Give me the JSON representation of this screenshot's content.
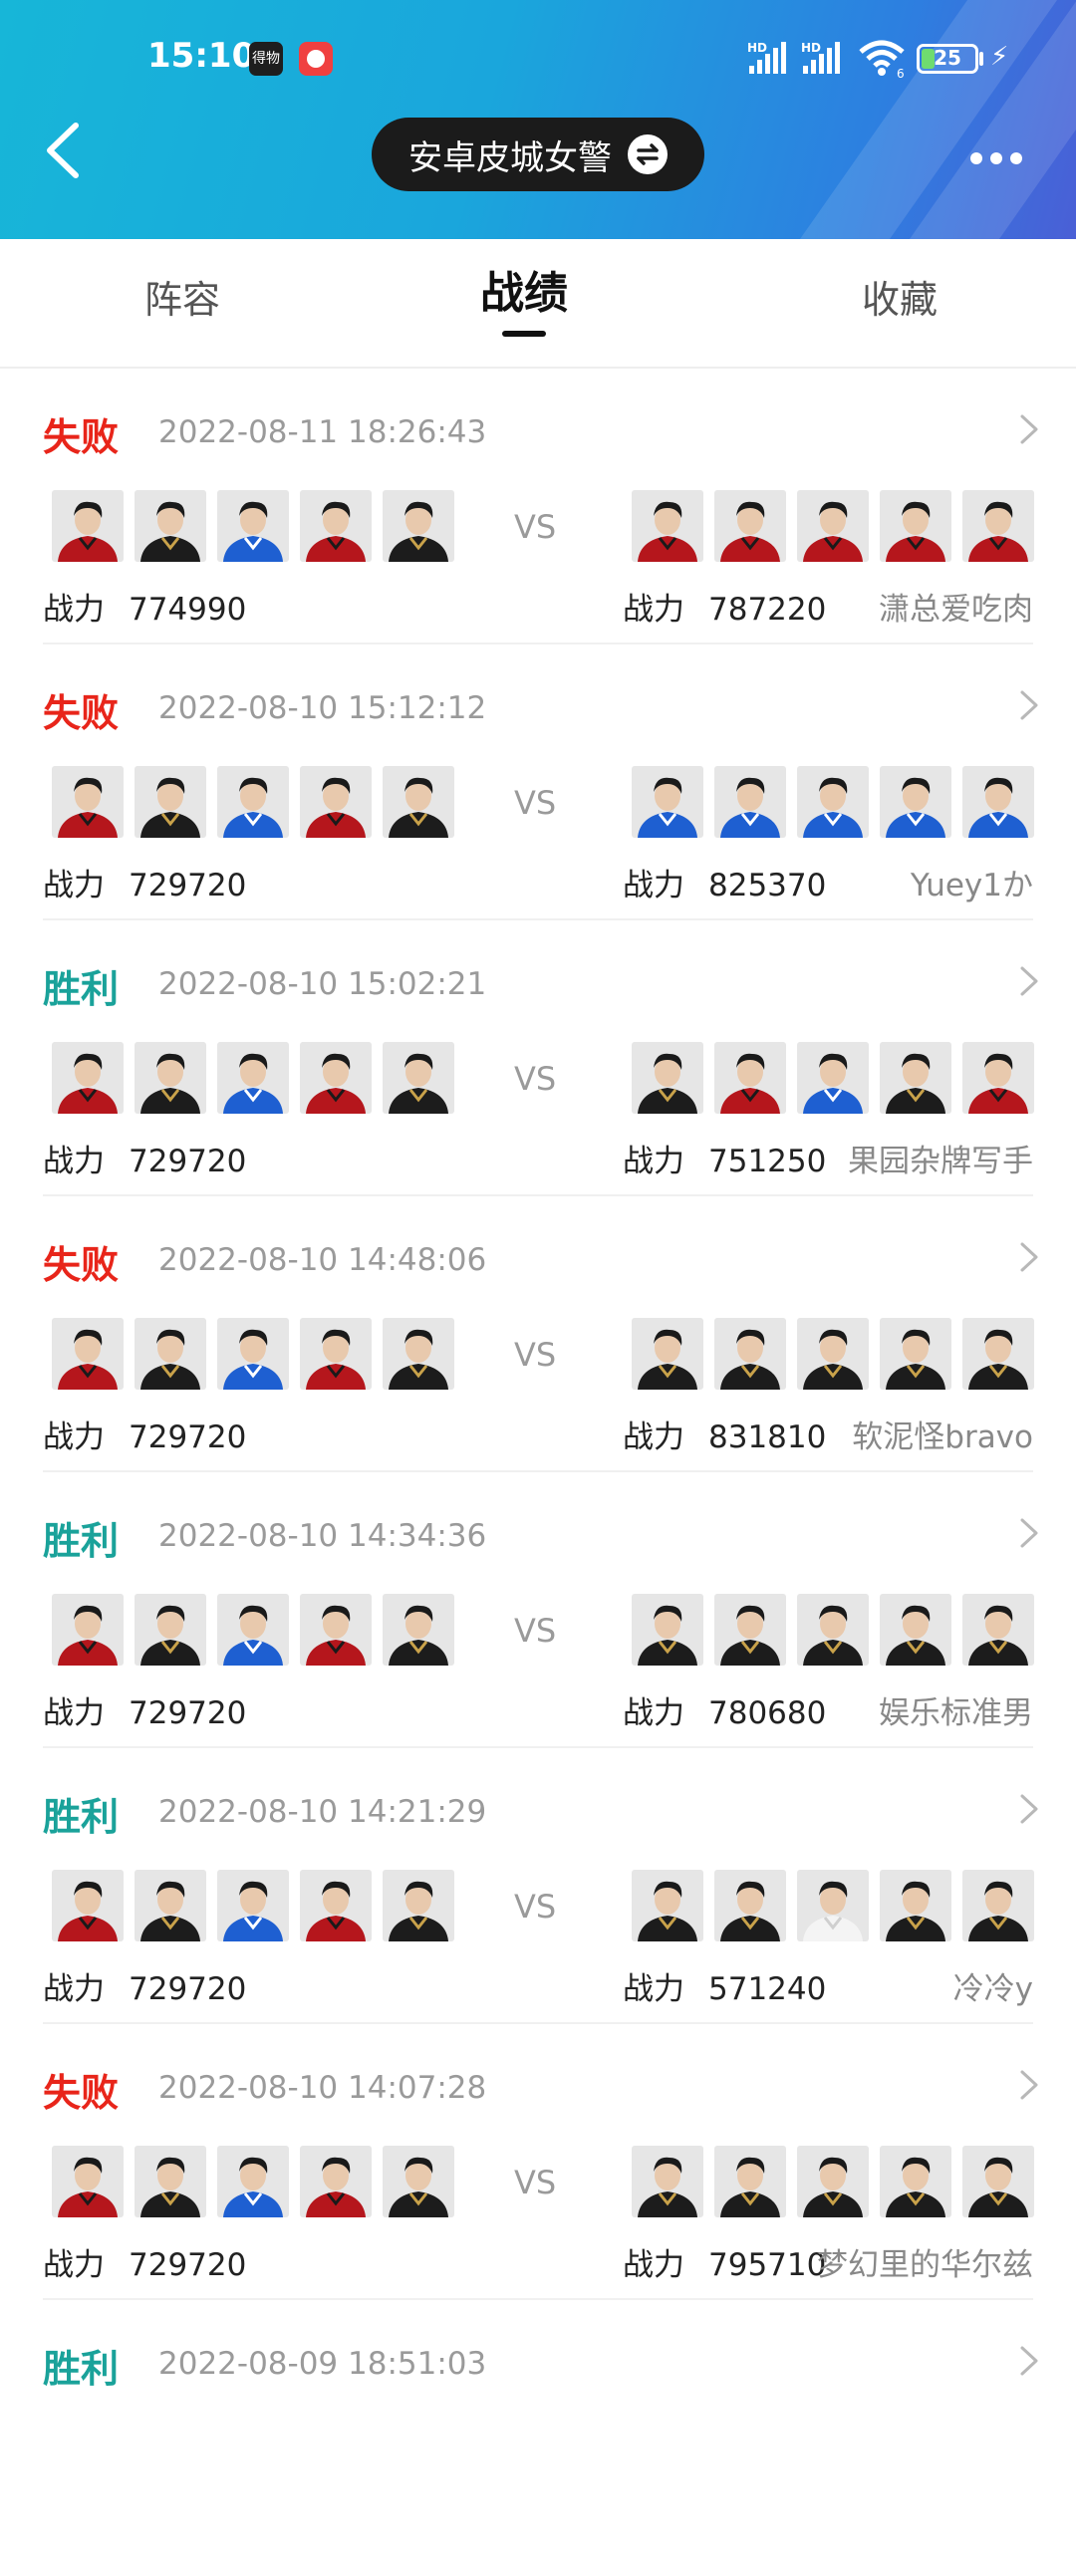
{
  "status_bar": {
    "time": "15:10",
    "app1_label": "得物",
    "battery": "25",
    "battery_level": 0.25,
    "network_1": "HD",
    "network_2": "HD",
    "wifi_label": "6"
  },
  "header": {
    "account_name": "安卓皮城女警"
  },
  "tabs": [
    {
      "label": "阵容",
      "active": false
    },
    {
      "label": "战绩",
      "active": true
    },
    {
      "label": "收藏",
      "active": false
    }
  ],
  "labels": {
    "vs": "VS",
    "power": "战力"
  },
  "colors": {
    "loss": "#e8251a",
    "win": "#1aa29a",
    "header_start": "#17b6d8",
    "header_end": "#4a5fd6"
  },
  "matches": [
    {
      "result": "失败",
      "outcome": "loss",
      "datetime": "2022-08-11 18:26:43",
      "my_power": "774990",
      "opp_power": "787220",
      "opponent": "潇总爱吃肉",
      "my_team": [
        "red",
        "black",
        "blue",
        "red",
        "black"
      ],
      "opp_team": [
        "red",
        "red",
        "red",
        "red",
        "red"
      ]
    },
    {
      "result": "失败",
      "outcome": "loss",
      "datetime": "2022-08-10 15:12:12",
      "my_power": "729720",
      "opp_power": "825370",
      "opponent": "Yuey1か",
      "my_team": [
        "red",
        "black",
        "blue",
        "red",
        "black"
      ],
      "opp_team": [
        "blue",
        "blue",
        "blue",
        "blue",
        "blue"
      ]
    },
    {
      "result": "胜利",
      "outcome": "win",
      "datetime": "2022-08-10 15:02:21",
      "my_power": "729720",
      "opp_power": "751250",
      "opponent": "果园杂牌写手",
      "my_team": [
        "red",
        "black",
        "blue",
        "red",
        "black"
      ],
      "opp_team": [
        "black",
        "red",
        "blue",
        "black",
        "red"
      ]
    },
    {
      "result": "失败",
      "outcome": "loss",
      "datetime": "2022-08-10 14:48:06",
      "my_power": "729720",
      "opp_power": "831810",
      "opponent": "软泥怪bravo",
      "my_team": [
        "red",
        "black",
        "blue",
        "red",
        "black"
      ],
      "opp_team": [
        "black",
        "black",
        "black",
        "black",
        "black"
      ]
    },
    {
      "result": "胜利",
      "outcome": "win",
      "datetime": "2022-08-10 14:34:36",
      "my_power": "729720",
      "opp_power": "780680",
      "opponent": "娱乐标准男",
      "my_team": [
        "red",
        "black",
        "blue",
        "red",
        "black"
      ],
      "opp_team": [
        "black",
        "black",
        "black",
        "black",
        "black"
      ]
    },
    {
      "result": "胜利",
      "outcome": "win",
      "datetime": "2022-08-10 14:21:29",
      "my_power": "729720",
      "opp_power": "571240",
      "opponent": "冷冷y",
      "my_team": [
        "red",
        "black",
        "blue",
        "red",
        "black"
      ],
      "opp_team": [
        "black",
        "black",
        "white",
        "black",
        "black"
      ]
    },
    {
      "result": "失败",
      "outcome": "loss",
      "datetime": "2022-08-10 14:07:28",
      "my_power": "729720",
      "opp_power": "795710",
      "opponent": "梦幻里的华尔兹",
      "my_team": [
        "red",
        "black",
        "blue",
        "red",
        "black"
      ],
      "opp_team": [
        "black",
        "black",
        "black",
        "black",
        "black"
      ]
    },
    {
      "result": "胜利",
      "outcome": "win",
      "datetime": "2022-08-09 18:51:03",
      "my_power": "",
      "opp_power": "",
      "opponent": "",
      "my_team": [],
      "opp_team": []
    }
  ]
}
